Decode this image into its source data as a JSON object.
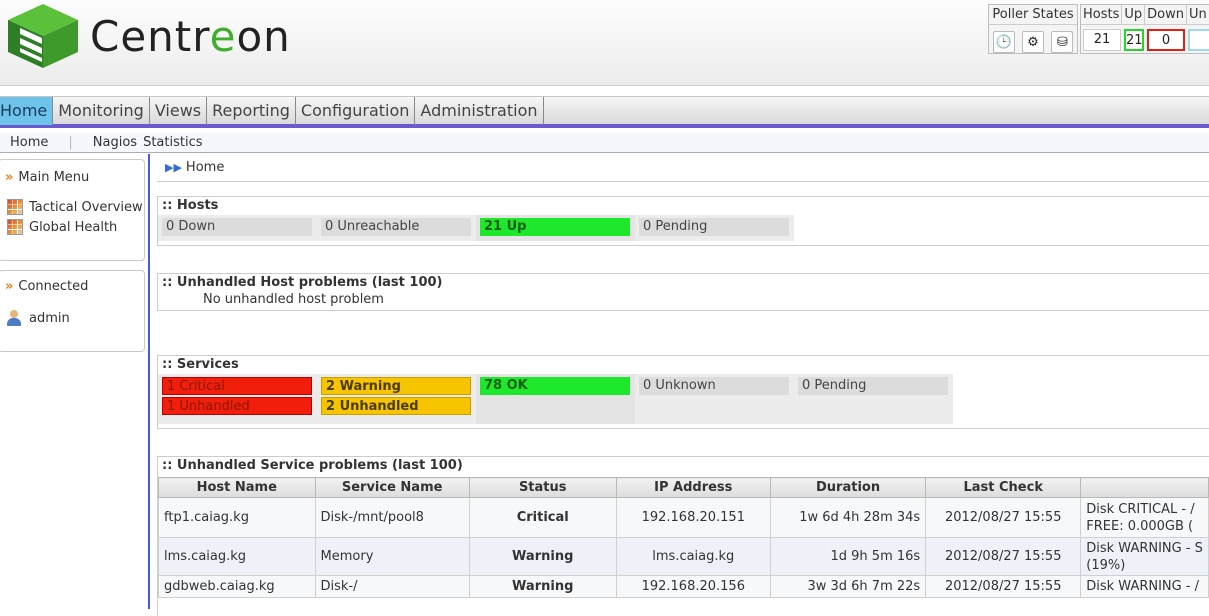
{
  "header": {
    "logo_prefix": "Centr",
    "logo_e": "e",
    "logo_suffix": "on",
    "poller_title": "Poller States",
    "hosts_labels": [
      "Hosts",
      "Up",
      "Down",
      "Un"
    ],
    "hosts_values": [
      "21",
      "21",
      "0",
      ""
    ]
  },
  "nav": {
    "items": [
      "Home",
      "Monitoring",
      "Views",
      "Reporting",
      "Configuration",
      "Administration"
    ],
    "active": "Home"
  },
  "subnav": [
    "Home",
    "Nagios",
    "Statistics"
  ],
  "sidebar": {
    "main_menu": "Main Menu",
    "items": [
      "Tactical Overview",
      "Global Health"
    ],
    "connected": "Connected",
    "user": "admin"
  },
  "breadcrumb": "Home",
  "hosts_panel": {
    "title": ":: Hosts",
    "down": "0 Down",
    "unreachable": "0 Unreachable",
    "up": "21 Up",
    "pending": "0 Pending"
  },
  "host_problems": {
    "title": ":: Unhandled Host problems (last 100)",
    "message": "No unhandled host problem"
  },
  "services_panel": {
    "title": ":: Services",
    "critical": "1 Critical",
    "critical_unhandled": "1 Unhandled",
    "warning": "2 Warning",
    "warning_unhandled": "2 Unhandled",
    "ok": "78 OK",
    "unknown": "0 Unknown",
    "pending": "0 Pending"
  },
  "service_problems": {
    "title": ":: Unhandled Service problems (last 100)",
    "columns": [
      "Host Name",
      "Service Name",
      "Status",
      "IP Address",
      "Duration",
      "Last Check",
      ""
    ],
    "rows": [
      {
        "host": "ftp1.caiag.kg",
        "service": "Disk-/mnt/pool8",
        "status": "Critical",
        "ip": "192.168.20.151",
        "duration": "1w 6d 4h 28m 34s",
        "last_check": "2012/08/27 15:55",
        "output1": "Disk CRITICAL - /",
        "output2": "FREE: 0.000GB ("
      },
      {
        "host": "lms.caiag.kg",
        "service": "Memory",
        "status": "Warning",
        "ip": "lms.caiag.kg",
        "duration": "1d 9h 5m 16s",
        "last_check": "2012/08/27 15:55",
        "output1": "Disk WARNING - S",
        "output2": "(19%)"
      },
      {
        "host": "gdbweb.caiag.kg",
        "service": "Disk-/",
        "status": "Warning",
        "ip": "192.168.20.156",
        "duration": "3w 3d 6h 7m 22s",
        "last_check": "2012/08/27 15:55",
        "output1": "Disk WARNING - /",
        "output2": ""
      }
    ]
  }
}
